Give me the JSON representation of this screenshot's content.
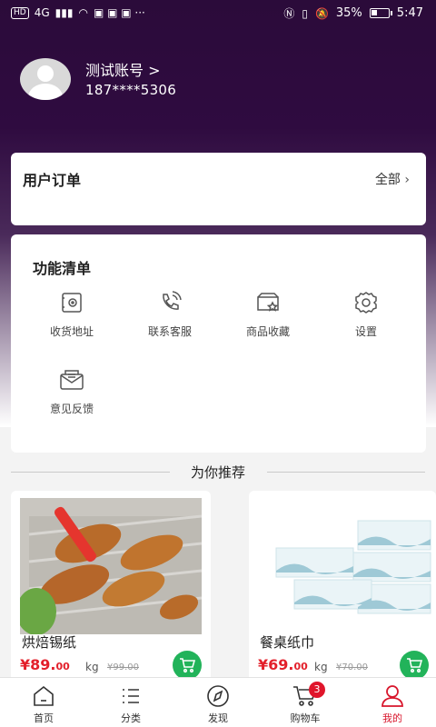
{
  "status_bar": {
    "left_chip": "HD",
    "network": "4G",
    "battery_text": "35%",
    "battery_level": 0.35,
    "time": "5:47"
  },
  "profile": {
    "name": "测试账号 >",
    "phone": "187****5306"
  },
  "orders": {
    "title": "用户订单",
    "all_label": "全部"
  },
  "functions": {
    "title": "功能清单",
    "items": [
      {
        "label": "收货地址",
        "icon": "safe-address-icon"
      },
      {
        "label": "联系客服",
        "icon": "phone-icon"
      },
      {
        "label": "商品收藏",
        "icon": "star-wallet-icon"
      },
      {
        "label": "设置",
        "icon": "gear-icon"
      },
      {
        "label": "意见反馈",
        "icon": "mail-icon"
      }
    ]
  },
  "recommend": {
    "title": "为你推荐"
  },
  "products": [
    {
      "name": "烘焙锡纸",
      "price_int": "¥89.",
      "price_dec": "00",
      "unit": "kg",
      "original": "¥99.00"
    },
    {
      "name": "餐桌纸巾",
      "price_int": "¥69.",
      "price_dec": "00",
      "unit": "kg",
      "original": "¥70.00"
    }
  ],
  "tabs": [
    {
      "label": "首页",
      "icon": "home-icon"
    },
    {
      "label": "分类",
      "icon": "list-icon"
    },
    {
      "label": "发现",
      "icon": "compass-icon"
    },
    {
      "label": "购物车",
      "icon": "cart-icon",
      "badge": "3"
    },
    {
      "label": "我的",
      "icon": "user-icon",
      "active": true
    }
  ],
  "colors": {
    "header": "#2f0b40",
    "price": "#e3202b",
    "cart_button": "#22b35a",
    "active_tab": "#d8162c"
  }
}
